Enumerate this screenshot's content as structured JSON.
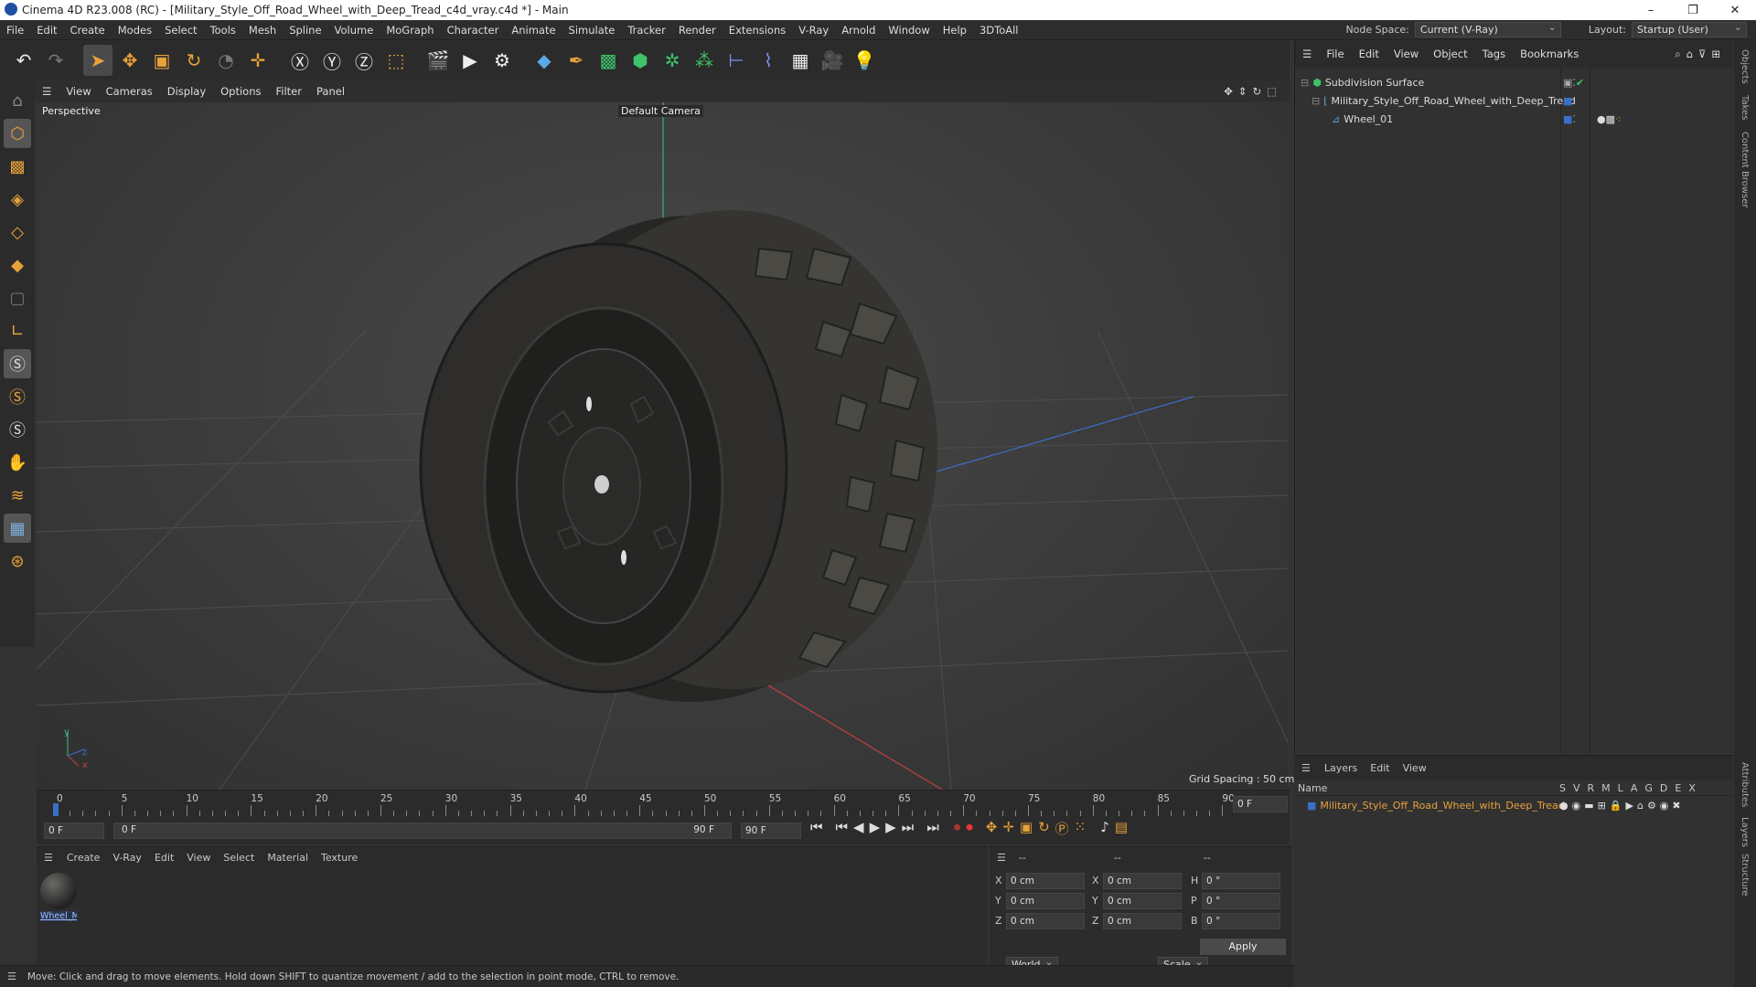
{
  "title_bar": {
    "title": "Cinema 4D R23.008 (RC) - [Military_Style_Off_Road_Wheel_with_Deep_Tread_c4d_vray.c4d *] - Main",
    "minimize": "–",
    "maximize": "❐",
    "close": "✕"
  },
  "menu": {
    "items": [
      "File",
      "Edit",
      "Create",
      "Modes",
      "Select",
      "Tools",
      "Mesh",
      "Spline",
      "Volume",
      "MoGraph",
      "Character",
      "Animate",
      "Simulate",
      "Tracker",
      "Render",
      "Extensions",
      "V-Ray",
      "Arnold",
      "Window",
      "Help",
      "3DToAll"
    ],
    "node_space_label": "Node Space:",
    "node_space_value": "Current (V-Ray)",
    "layout_label": "Layout:",
    "layout_value": "Startup (User)"
  },
  "toolbar": {
    "icons": [
      "undo-icon",
      "redo-icon",
      "select-icon",
      "move-icon",
      "scale-icon",
      "rotate-icon",
      "recent-icon",
      "add-icon",
      "x-axis-icon",
      "y-axis-icon",
      "z-axis-icon",
      "coord-system-icon",
      "render-region-icon",
      "render-view-icon",
      "render-settings-icon",
      "cube-icon",
      "pen-icon",
      "subdivision-icon",
      "extrude-icon",
      "array-icon",
      "cloner-icon",
      "deformer-icon",
      "spline-icon",
      "floor-icon",
      "camera-icon",
      "light-icon"
    ]
  },
  "viewport_menu": {
    "items": [
      "View",
      "Cameras",
      "Display",
      "Options",
      "Filter",
      "Panel"
    ]
  },
  "viewport": {
    "name": "Perspective",
    "camera": "Default Camera",
    "grid_spacing": "Grid Spacing : 50 cm",
    "axis_y": "y",
    "axis_z": "z",
    "axis_x": "x"
  },
  "timeline": {
    "ticks": [
      "0",
      "5",
      "10",
      "15",
      "20",
      "25",
      "30",
      "35",
      "40",
      "45",
      "50",
      "55",
      "60",
      "65",
      "70",
      "75",
      "80",
      "85",
      "90"
    ],
    "current": "0 F"
  },
  "playback": {
    "start": "0 F",
    "range_start": "0 F",
    "range_end": "90 F",
    "end": "90 F"
  },
  "materials": {
    "menu": [
      "Create",
      "V-Ray",
      "Edit",
      "View",
      "Select",
      "Material",
      "Texture"
    ],
    "items": [
      {
        "name": "Wheel_M"
      }
    ]
  },
  "coords": {
    "headers": [
      "--",
      "--",
      "--"
    ],
    "rows": [
      {
        "a": "X",
        "av": "0 cm",
        "b": "X",
        "bv": "0 cm",
        "c": "H",
        "cv": "0 °"
      },
      {
        "a": "Y",
        "av": "0 cm",
        "b": "Y",
        "bv": "0 cm",
        "c": "P",
        "cv": "0 °"
      },
      {
        "a": "Z",
        "av": "0 cm",
        "b": "Z",
        "bv": "0 cm",
        "c": "B",
        "cv": "0 °"
      }
    ],
    "world": "World",
    "scale": "Scale",
    "apply": "Apply"
  },
  "status": "Move: Click and drag to move elements. Hold down SHIFT to quantize movement / add to the selection in point mode, CTRL to remove.",
  "objects": {
    "menu": [
      "File",
      "Edit",
      "View",
      "Object",
      "Tags",
      "Bookmarks"
    ],
    "tree": [
      {
        "name": "Subdivision Surface",
        "indent": 0
      },
      {
        "name": "Military_Style_Off_Road_Wheel_with_Deep_Tread",
        "indent": 1
      },
      {
        "name": "Wheel_01",
        "indent": 2
      }
    ]
  },
  "layers": {
    "menu": [
      "Layers",
      "Edit",
      "View"
    ],
    "name_header": "Name",
    "cols": [
      "S",
      "V",
      "R",
      "M",
      "L",
      "A",
      "G",
      "D",
      "E",
      "X"
    ],
    "rows": [
      {
        "name": "Military_Style_Off_Road_Wheel_with_Deep_Tread"
      }
    ]
  },
  "side_tabs": [
    "Objects",
    "Takes",
    "Content Browser",
    "Attributes",
    "Layers",
    "Structure"
  ]
}
